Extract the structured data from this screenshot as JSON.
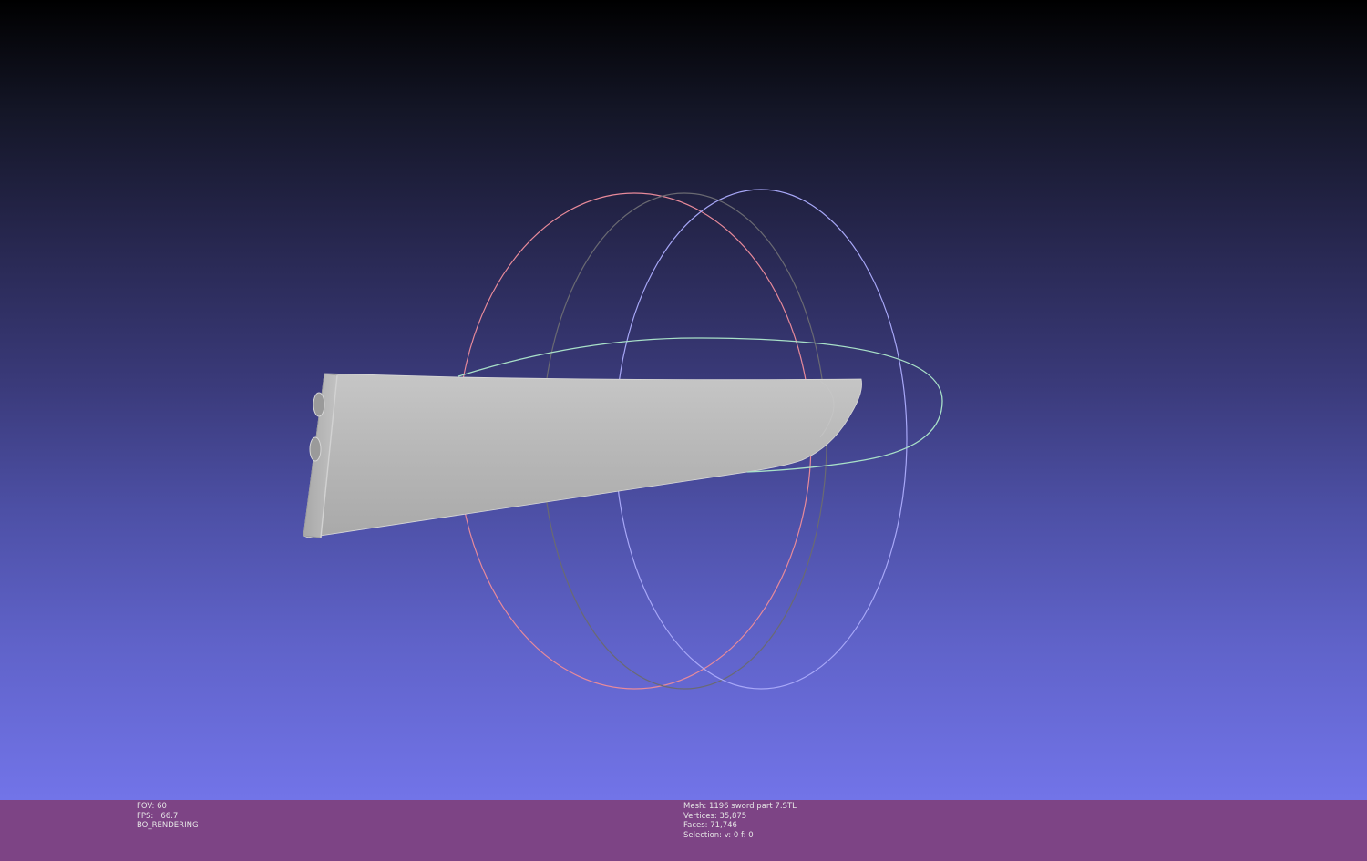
{
  "viewer": {
    "render_info": {
      "fov": "FOV: 60",
      "fps": "FPS:   66.7",
      "mode": "BO_RENDERING"
    },
    "mesh_info": {
      "mesh": "Mesh: 1196 sword part 7.STL",
      "vertices": "Vertices: 35,875",
      "faces": "Faces: 71,746",
      "selection": "Selection: v: 0 f: 0"
    }
  },
  "colors": {
    "infobar": "#7d4485",
    "background_top": "#000000",
    "background_bottom": "#7274e8",
    "mesh_fill": "#b9b9b9",
    "trackball_x": "#e88a9a",
    "trackball_y": "#a8a8f8",
    "trackball_z": "#a8e0c8"
  }
}
